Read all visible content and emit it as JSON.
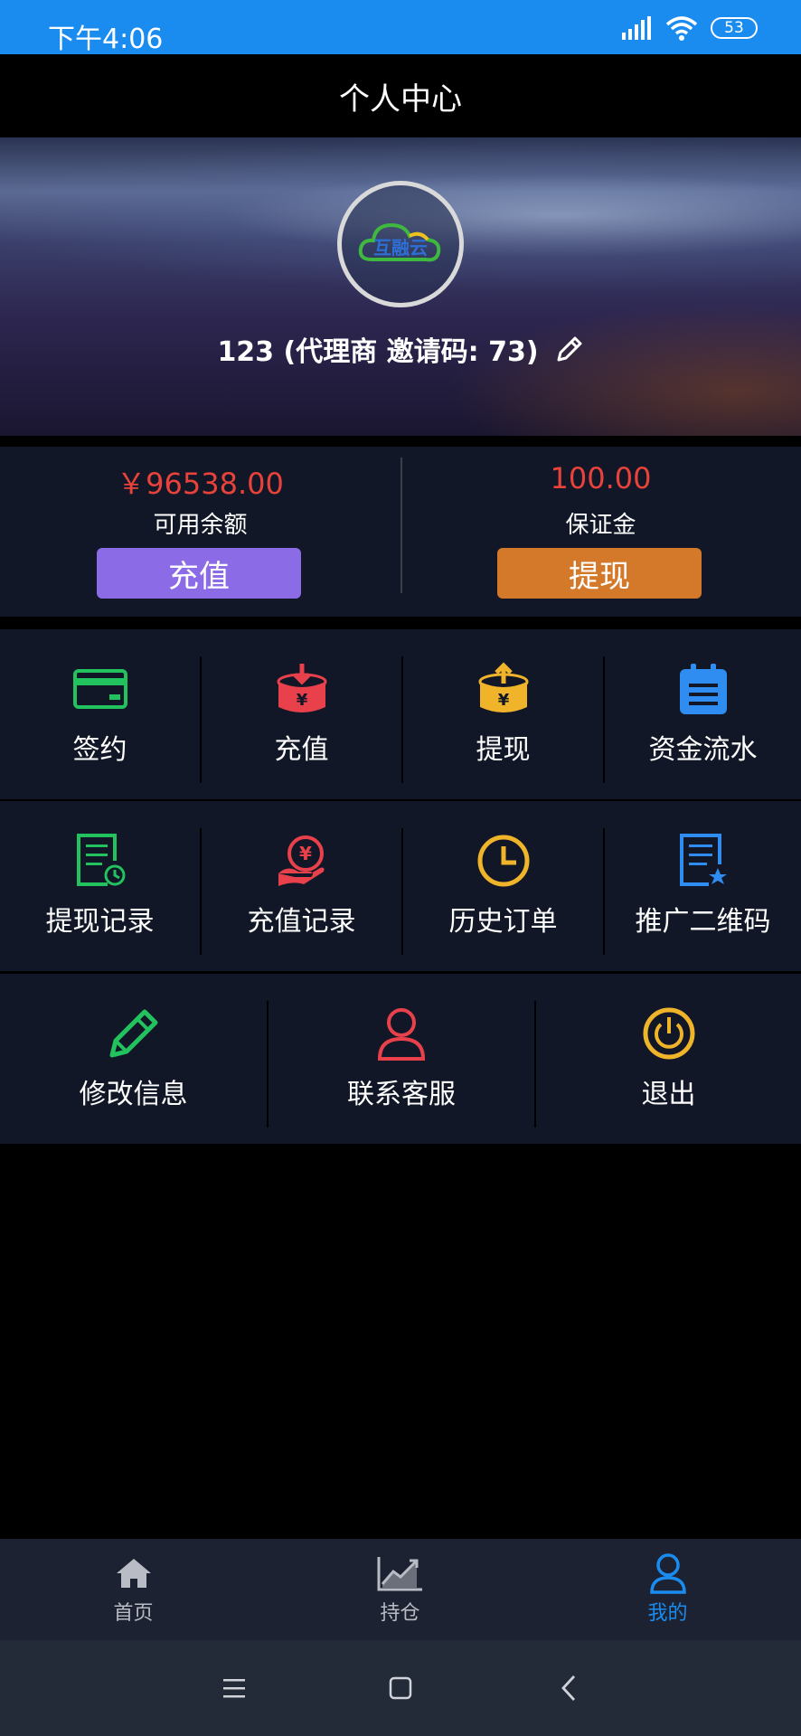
{
  "status_bar": {
    "time": "下午4:06",
    "battery": "53"
  },
  "header": {
    "title": "个人中心"
  },
  "profile": {
    "logo_text": "互融云",
    "name_line": "123 (代理商 邀请码: 73)"
  },
  "balance": {
    "available": {
      "amount": "￥96538.00",
      "label": "可用余额",
      "button": "充值",
      "button_color": "#8c6be6"
    },
    "deposit": {
      "amount": "100.00",
      "label": "保证金",
      "button": "提现",
      "button_color": "#d4782a"
    }
  },
  "menu_row1": [
    {
      "label": "签约",
      "icon": "card-icon",
      "color": "#22c35e"
    },
    {
      "label": "充值",
      "icon": "deposit-box-icon",
      "color": "#e8414b"
    },
    {
      "label": "提现",
      "icon": "withdraw-box-icon",
      "color": "#f0b42a"
    },
    {
      "label": "资金流水",
      "icon": "clipboard-icon",
      "color": "#2f8cf0"
    }
  ],
  "menu_row2": [
    {
      "label": "提现记录",
      "icon": "document-clock-icon",
      "color": "#22c35e"
    },
    {
      "label": "充值记录",
      "icon": "hand-coin-icon",
      "color": "#e8414b"
    },
    {
      "label": "历史订单",
      "icon": "clock-icon",
      "color": "#f0b42a"
    },
    {
      "label": "推广二维码",
      "icon": "document-star-icon",
      "color": "#2f8cf0"
    }
  ],
  "menu_row3": [
    {
      "label": "修改信息",
      "icon": "pencil-icon",
      "color": "#22c35e"
    },
    {
      "label": "联系客服",
      "icon": "person-icon",
      "color": "#e8414b"
    },
    {
      "label": "退出",
      "icon": "power-icon",
      "color": "#f0b42a"
    }
  ],
  "tabbar": [
    {
      "label": "首页",
      "icon": "home-icon"
    },
    {
      "label": "持仓",
      "icon": "chart-icon"
    },
    {
      "label": "我的",
      "icon": "user-icon",
      "active": true,
      "active_color": "#1a8cf0"
    }
  ]
}
